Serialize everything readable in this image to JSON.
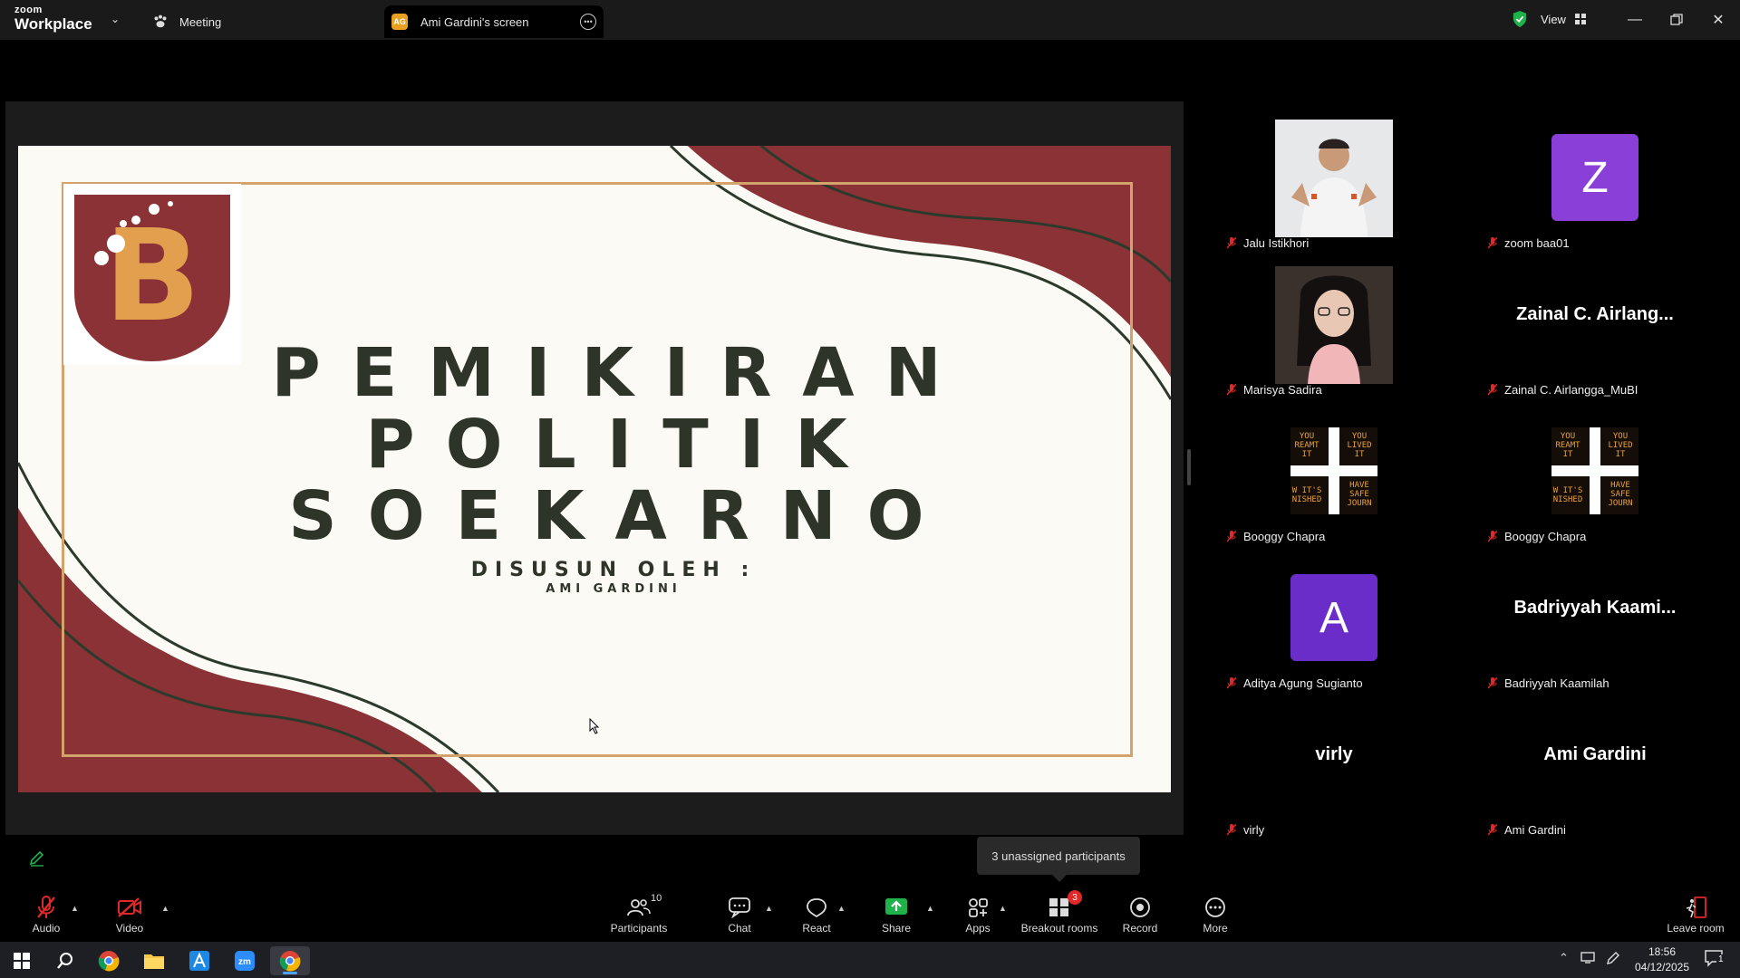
{
  "app": {
    "logo_top": "zoom",
    "logo_bottom": "Workplace"
  },
  "tabs": {
    "meeting": "Meeting",
    "screen": "Ami Gardini's screen",
    "screen_badge": "AG"
  },
  "view": {
    "label": "View"
  },
  "slide": {
    "title_lines": [
      "PEMIKIRAN",
      "POLITIK",
      "SOEKARNO"
    ],
    "subtitle": "DISUSUN OLEH :",
    "author": "AMI GARDINI",
    "logo_letter": "B"
  },
  "gallery": [
    {
      "name": "Jalu Istikhori",
      "type": "photo"
    },
    {
      "name": "zoom baa01",
      "type": "avatar",
      "letter": "Z",
      "color": "#8b3fd9"
    },
    {
      "name": "Marisya Sadira",
      "type": "photo"
    },
    {
      "name": "Zainal C. Airlangga_MuBI",
      "type": "text",
      "display": "Zainal C. Airlang..."
    },
    {
      "name": "Booggy Chapra",
      "type": "poster"
    },
    {
      "name": "Booggy Chapra",
      "type": "poster"
    },
    {
      "name": "Aditya Agung Sugianto",
      "type": "avatar",
      "letter": "A",
      "color": "#6a2dc9"
    },
    {
      "name": "Badriyyah Kaamilah",
      "type": "text",
      "display": "Badriyyah Kaami..."
    },
    {
      "name": "virly",
      "type": "text",
      "display": "virly"
    },
    {
      "name": "Ami Gardini",
      "type": "text",
      "display": "Ami Gardini"
    }
  ],
  "poster_text": {
    "tl": "YOU\nREAMT\nIT",
    "tr": "YOU\nLIVED\nIT",
    "bl": "W IT'S\nNISHED",
    "br": "HAVE\nSAFE\nJOURN"
  },
  "unassigned": "3 unassigned participants",
  "toolbar": {
    "audio": "Audio",
    "video": "Video",
    "participants": "Participants",
    "participants_count": "10",
    "chat": "Chat",
    "react": "React",
    "share": "Share",
    "apps": "Apps",
    "breakout": "Breakout rooms",
    "breakout_badge": "3",
    "record": "Record",
    "more": "More",
    "leave": "Leave room"
  },
  "taskbar": {
    "time": "18:56",
    "date": "04/12/2025",
    "notification_count": "1"
  },
  "colors": {
    "accent_green": "#1fb24a",
    "mute_red": "#e02828",
    "slide_maroon": "#8a3235",
    "slide_gold": "#d4a36b",
    "slide_text": "#2f3429"
  }
}
